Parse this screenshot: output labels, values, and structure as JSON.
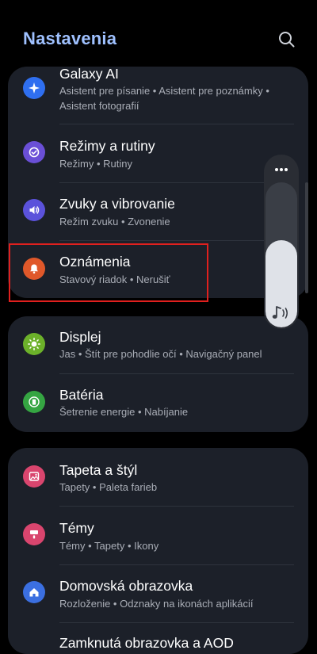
{
  "header": {
    "title": "Nastavenia",
    "search_icon": "search-icon"
  },
  "colors": {
    "title": "#9fc1ff",
    "card_bg": "#1c2029",
    "highlight": "#e0201e"
  },
  "cards": [
    {
      "items": [
        {
          "title": "Galaxy AI",
          "subtitle": "Asistent pre písanie  •  Asistent pre poznámky  •  Asistent fotografií",
          "icon": "sparkle-icon",
          "icon_color": "#2f6ff0"
        },
        {
          "title": "Režimy a rutiny",
          "subtitle": "Režimy  •  Rutiny",
          "icon": "routine-check-icon",
          "icon_color": "#6a4fd6"
        },
        {
          "title": "Zvuky a vibrovanie",
          "subtitle": "Režim zvuku  •  Zvonenie",
          "icon": "speaker-icon",
          "icon_color": "#5b52db"
        },
        {
          "title": "Oznámenia",
          "subtitle": "Stavový riadok  •  Nerušiť",
          "icon": "bell-icon",
          "icon_color": "#e0582a"
        }
      ]
    },
    {
      "items": [
        {
          "title": "Displej",
          "subtitle": "Jas  •  Štít pre pohodlie očí  •  Navigačný panel",
          "icon": "sun-icon",
          "icon_color": "#6cb12a"
        },
        {
          "title": "Batéria",
          "subtitle": "Šetrenie energie  •  Nabíjanie",
          "icon": "battery-icon",
          "icon_color": "#35a542"
        }
      ]
    },
    {
      "items": [
        {
          "title": "Tapeta a štýl",
          "subtitle": "Tapety  •  Paleta farieb",
          "icon": "wallpaper-icon",
          "icon_color": "#d9456e"
        },
        {
          "title": "Témy",
          "subtitle": "Témy  •  Tapety  •  Ikony",
          "icon": "theme-brush-icon",
          "icon_color": "#d9456e"
        },
        {
          "title": "Domovská obrazovka",
          "subtitle": "Rozloženie  •  Odznaky na ikonách aplikácií",
          "icon": "home-icon",
          "icon_color": "#3b6fe0"
        },
        {
          "title": "Zamknutá obrazovka a AOD",
          "subtitle": "",
          "icon": "lock-icon",
          "icon_color": "#3b6fe0"
        }
      ]
    }
  ],
  "volume": {
    "level": 0.6,
    "more_icon": "more-dots-icon",
    "stream_icon": "music-note-icon"
  }
}
